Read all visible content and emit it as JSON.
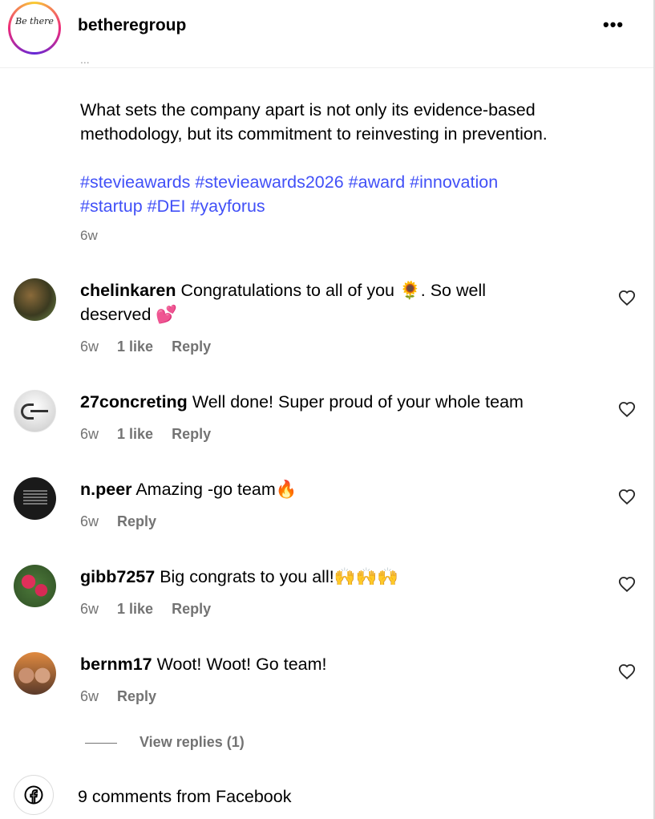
{
  "header": {
    "avatar_text": "Be there",
    "username": "betheregroup",
    "more": "•••"
  },
  "post": {
    "partial_previous_line": "...",
    "caption": "What sets the company apart is not only its evidence-based methodology, but its commitment to reinvesting in prevention.",
    "hashtags": [
      "#stevieawards",
      "#stevieawards2026",
      "#award",
      "#innovation",
      "#startup",
      "#DEI",
      "#yayforus"
    ],
    "time": "6w"
  },
  "comments": [
    {
      "username": "chelinkaren",
      "text": "Congratulations to all of you 🌻. So well deserved 💕",
      "time": "6w",
      "likes": "1 like",
      "reply": "Reply"
    },
    {
      "username": "27concreting",
      "text": "Well done! Super proud of your whole team",
      "time": "6w",
      "likes": "1 like",
      "reply": "Reply"
    },
    {
      "username": "n.peer",
      "text": "Amazing -go team🔥",
      "time": "6w",
      "likes": "",
      "reply": "Reply"
    },
    {
      "username": "gibb7257",
      "text": "Big congrats to you all!🙌🙌🙌",
      "time": "6w",
      "likes": "1 like",
      "reply": "Reply"
    },
    {
      "username": "bernm17",
      "text": "Woot! Woot! Go team!",
      "time": "6w",
      "likes": "",
      "reply": "Reply"
    }
  ],
  "view_replies": "View replies (1)",
  "facebook": {
    "label": "9 comments from Facebook",
    "icon": "facebook-icon"
  },
  "colors": {
    "link": "#4150f7",
    "meta": "#737373",
    "border": "#dbdbdb"
  }
}
